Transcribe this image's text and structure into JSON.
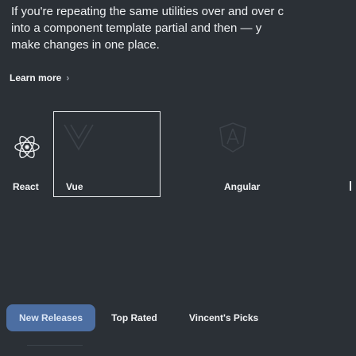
{
  "intro": {
    "lines": [
      "If you're repeating the same utilities over and over c",
      "into a component template partial and then — y",
      "make changes in one place."
    ]
  },
  "learn_more": {
    "label": "Learn more",
    "chevron": "›"
  },
  "frameworks": [
    {
      "name": "React",
      "icon": "react-icon",
      "selected": false
    },
    {
      "name": "Vue",
      "icon": "vue-icon",
      "selected": true
    },
    {
      "name": "Angular",
      "icon": "angular-icon",
      "selected": false
    },
    {
      "name": "",
      "icon": "",
      "selected": false
    }
  ],
  "filters": [
    {
      "label": "New Releases",
      "active": true
    },
    {
      "label": "Top Rated",
      "active": false
    },
    {
      "label": "Vincent's Picks",
      "active": false
    }
  ],
  "colors": {
    "background": "#2b3036",
    "active_chip": "#4c6ea2",
    "selected_border": "#e9ebee"
  }
}
